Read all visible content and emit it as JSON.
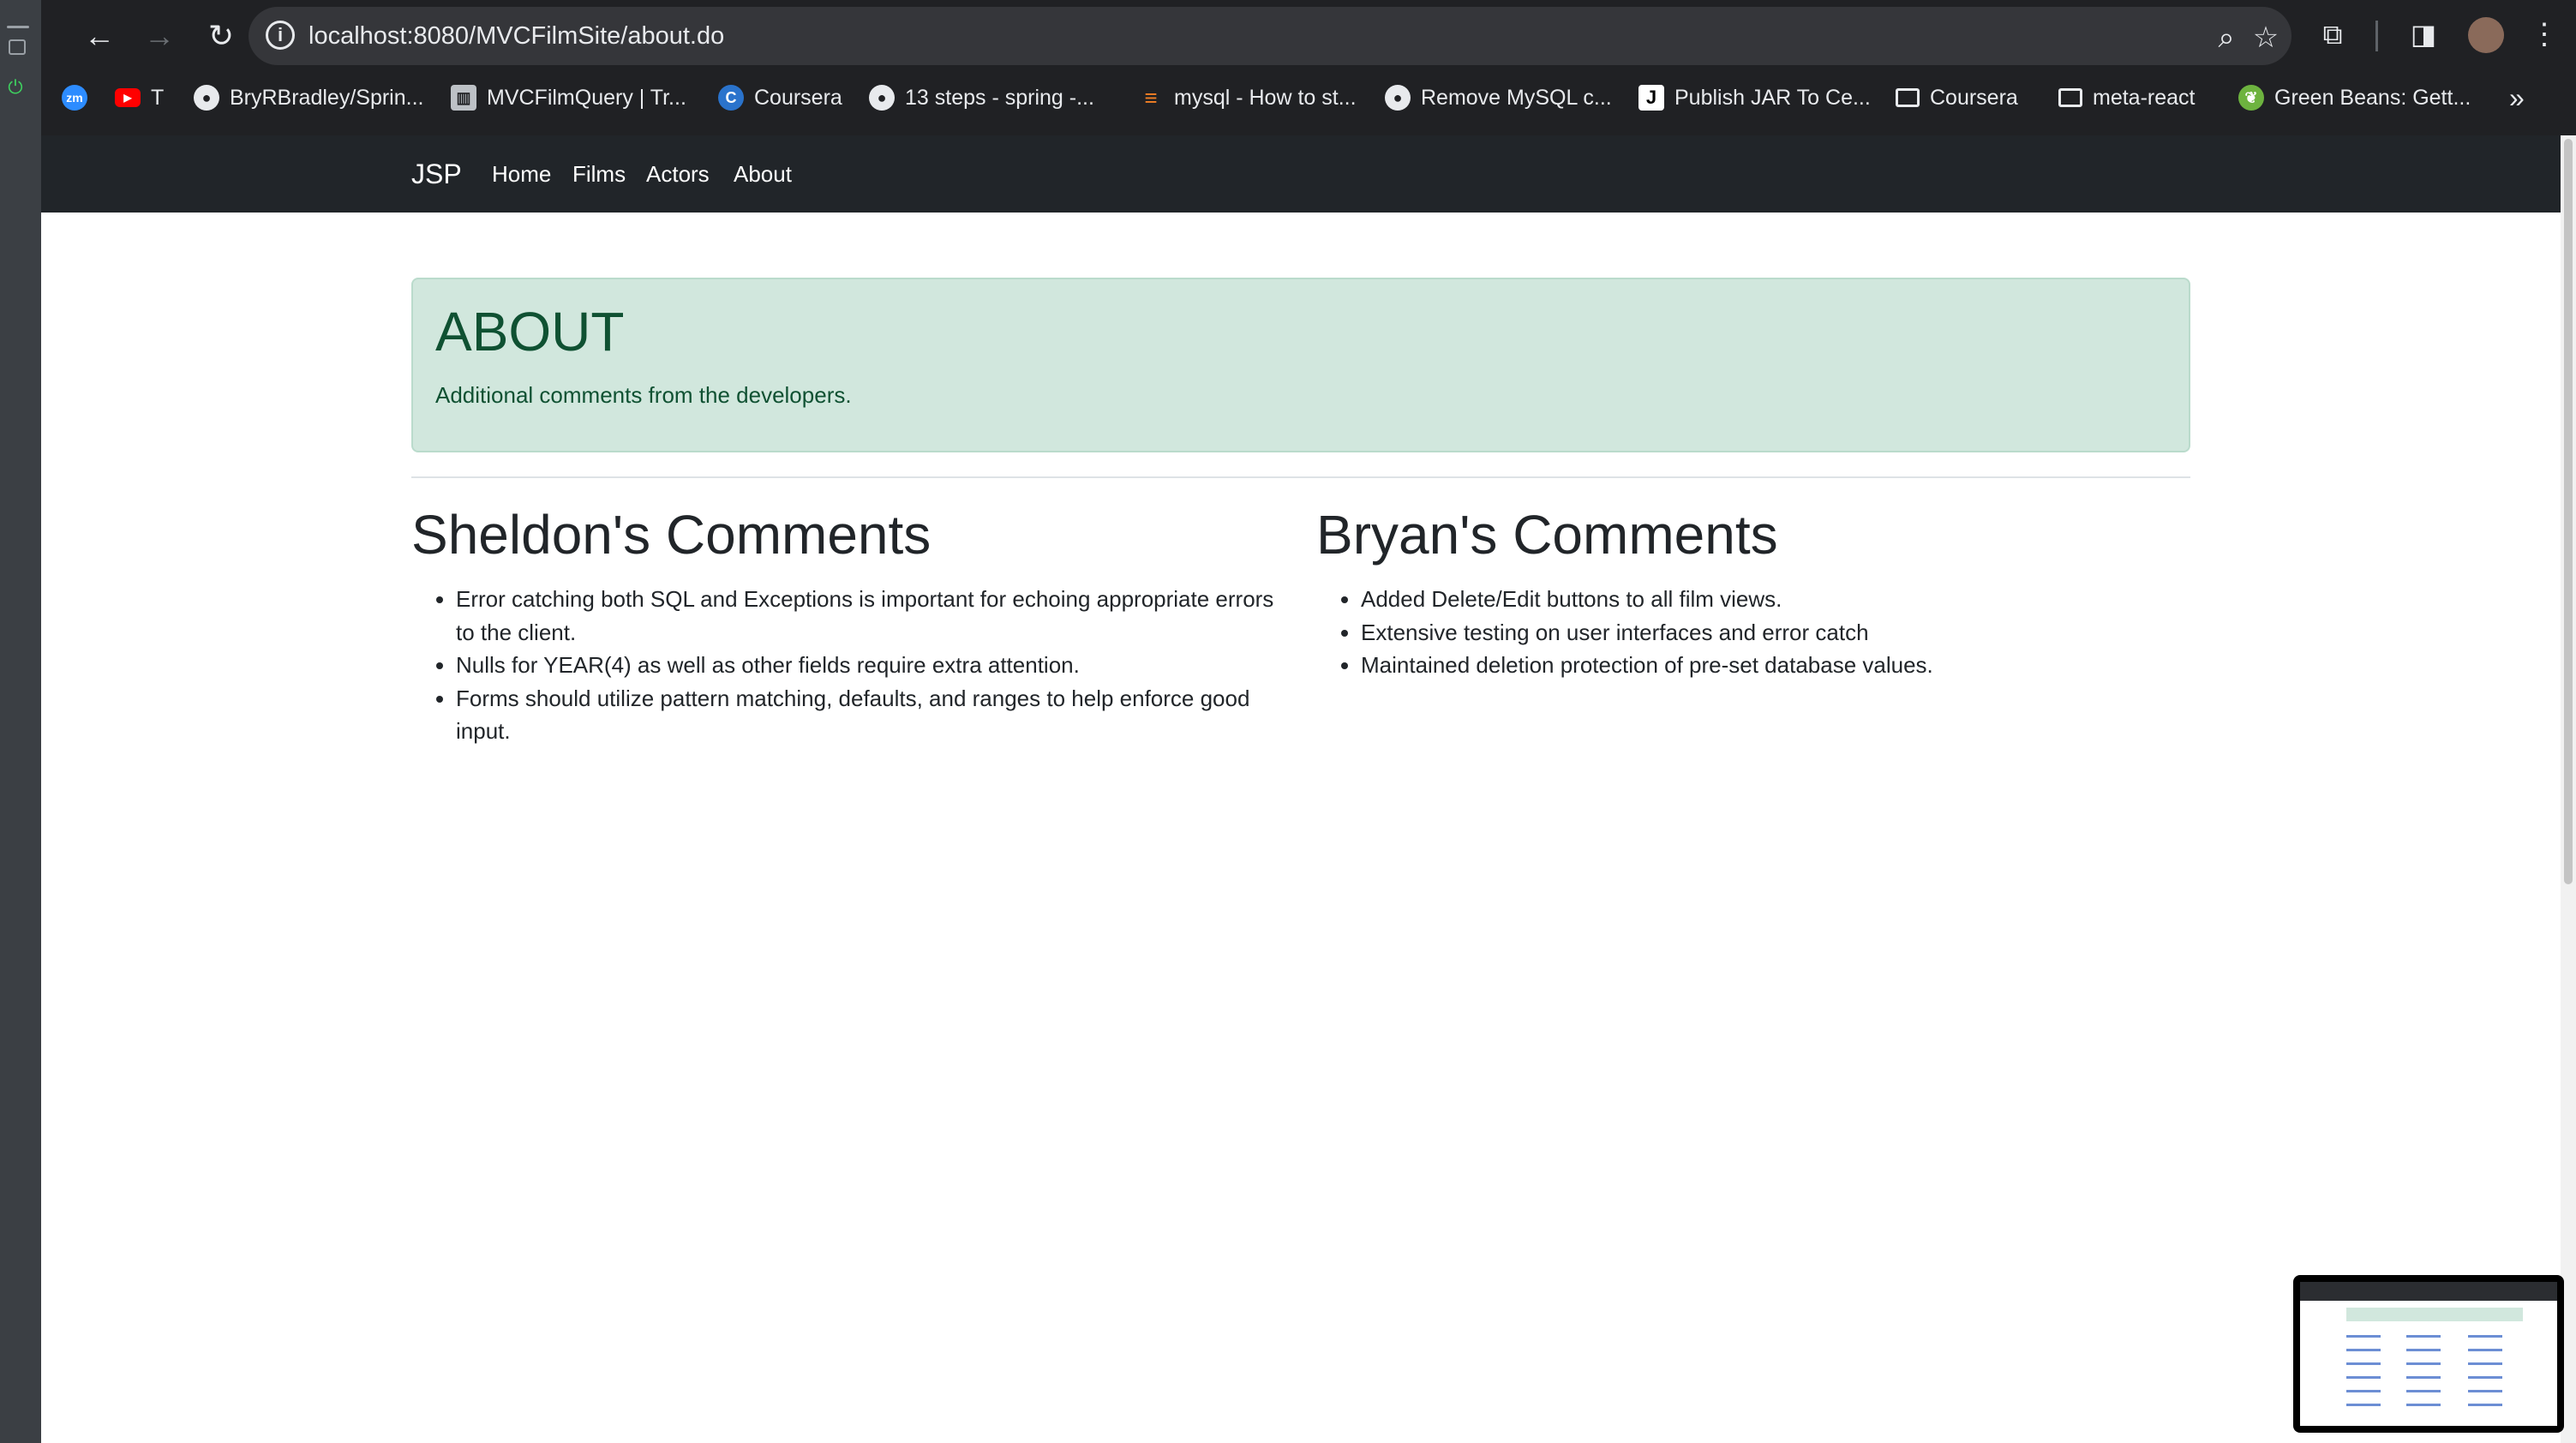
{
  "browser": {
    "url": "localhost:8080/MVCFilmSite/about.do",
    "bookmarks": [
      {
        "label": "",
        "icon": "zoom-icon",
        "glyph": "zm"
      },
      {
        "label": "T",
        "icon": "youtube-icon",
        "glyph": "▶"
      },
      {
        "label": "BryRBradley/Sprin...",
        "icon": "github-icon",
        "glyph": "●"
      },
      {
        "label": "MVCFilmQuery | Tr...",
        "icon": "board-icon",
        "glyph": "▥"
      },
      {
        "label": "Coursera",
        "icon": "coursera-icon",
        "glyph": "C"
      },
      {
        "label": "13 steps - spring -...",
        "icon": "github-icon",
        "glyph": "●"
      },
      {
        "label": "mysql - How to st...",
        "icon": "stackoverflow-icon",
        "glyph": "≡"
      },
      {
        "label": "Remove MySQL c...",
        "icon": "github-icon",
        "glyph": "●"
      },
      {
        "label": "Publish JAR To Ce...",
        "icon": "j-icon",
        "glyph": "J"
      },
      {
        "label": "Coursera",
        "icon": "folder-icon",
        "glyph": ""
      },
      {
        "label": "meta-react",
        "icon": "folder-icon",
        "glyph": ""
      },
      {
        "label": "Green Beans: Gett...",
        "icon": "spring-icon",
        "glyph": "❦"
      }
    ]
  },
  "navbar": {
    "brand": "JSP",
    "links": [
      "Home",
      "Films",
      "Actors",
      "About"
    ]
  },
  "header": {
    "title": "ABOUT",
    "subtitle": "Additional comments from the developers."
  },
  "sheldon": {
    "heading": "Sheldon's Comments",
    "items": [
      "Error catching both SQL and Exceptions is important for echoing appropriate errors to the client.",
      "Nulls for YEAR(4) as well as other fields require extra attention.",
      "Forms should utilize pattern matching, defaults, and ranges to help enforce good input."
    ]
  },
  "bryan": {
    "heading": "Bryan's Comments",
    "items": [
      "Added Delete/Edit buttons to all film views.",
      "Extensive testing on user interfaces and error catch",
      "Maintained deletion protection of pre-set database values."
    ]
  },
  "colors": {
    "navbar_bg": "#212529",
    "jumbotron_bg": "#d1e7dd",
    "jumbotron_text": "#0f5132",
    "chrome_bg": "#202124"
  }
}
